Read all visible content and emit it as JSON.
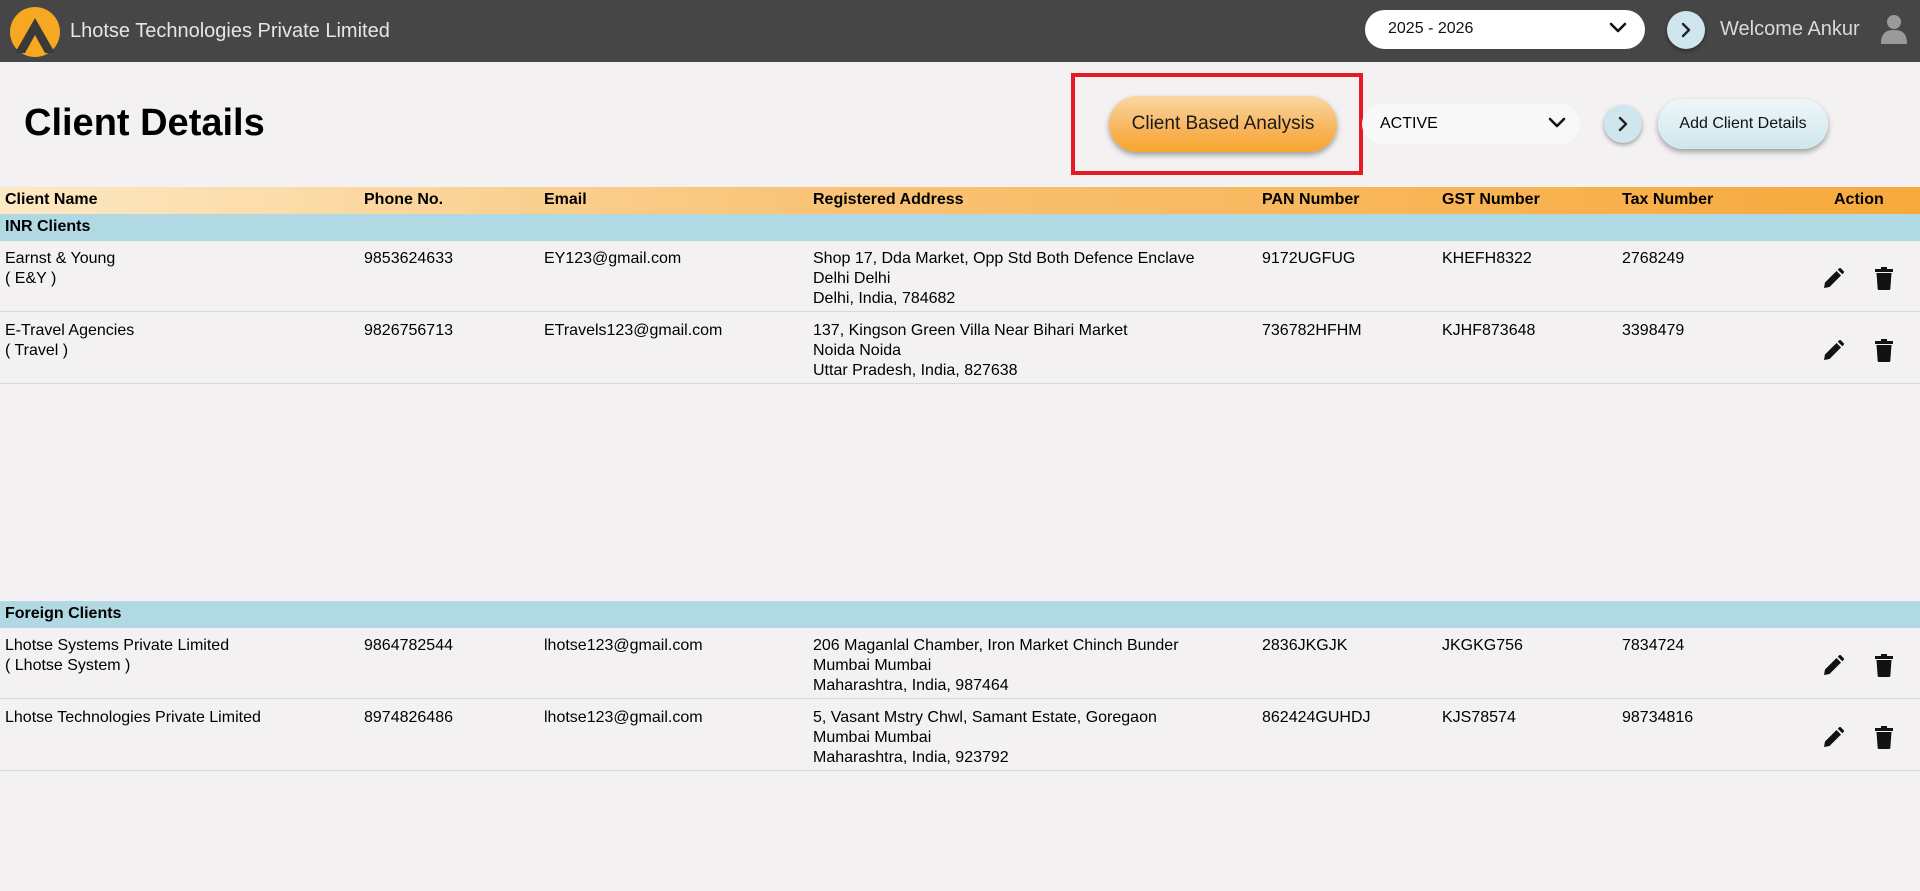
{
  "topbar": {
    "company": "Lhotse Technologies Private Limited",
    "year": "2025 - 2026",
    "welcome": "Welcome Ankur",
    "colors": {
      "bar": "#464646",
      "logo": "#f7a823"
    }
  },
  "header": {
    "title": "Client Details",
    "analysis_label": "Client Based Analysis",
    "status": "ACTIVE",
    "add_label": "Add Client Details",
    "highlight_color": "#e41b23"
  },
  "table": {
    "columns": [
      "Client Name",
      "Phone No.",
      "Email",
      "Registered Address",
      "PAN Number",
      "GST Number",
      "Tax Number",
      "Action"
    ],
    "groups": [
      {
        "label": "INR Clients",
        "rows": [
          {
            "name": "Earnst & Young",
            "alias": "( E&Y )",
            "phone": "9853624633",
            "email": "EY123@gmail.com",
            "addr1": "Shop 17, Dda Market, Opp Std Both Defence Enclave",
            "addr2": "Delhi Delhi",
            "addr3": "Delhi, India, 784682",
            "pan": "9172UGFUG",
            "gst": "KHEFH8322",
            "tax": "2768249"
          },
          {
            "name": "E-Travel Agencies",
            "alias": "( Travel )",
            "phone": "9826756713",
            "email": "ETravels123@gmail.com",
            "addr1": "137, Kingson Green Villa Near Bihari Market",
            "addr2": "Noida Noida",
            "addr3": "Uttar Pradesh, India, 827638",
            "pan": "736782HFHM",
            "gst": "KJHF873648",
            "tax": "3398479"
          }
        ]
      },
      {
        "label": "Foreign Clients",
        "rows": [
          {
            "name": "Lhotse Systems Private Limited",
            "alias": "( Lhotse System )",
            "phone": "9864782544",
            "email": "lhotse123@gmail.com",
            "addr1": "206 Maganlal Chamber, Iron Market Chinch Bunder",
            "addr2": "Mumbai Mumbai",
            "addr3": "Maharashtra, India, 987464",
            "pan": "2836JKGJK",
            "gst": "JKGKG756",
            "tax": "7834724"
          },
          {
            "name": "Lhotse Technologies Private Limited",
            "alias": "",
            "phone": "8974826486",
            "email": "lhotse123@gmail.com",
            "addr1": "5, Vasant Mstry Chwl, Samant Estate, Goregaon",
            "addr2": "Mumbai Mumbai",
            "addr3": "Maharashtra, India, 923792",
            "pan": "862424GUHDJ",
            "gst": "KJS78574",
            "tax": "98734816"
          }
        ]
      }
    ]
  },
  "icons": {
    "edit": "pencil-icon",
    "delete": "trash-icon",
    "user": "user-icon"
  }
}
